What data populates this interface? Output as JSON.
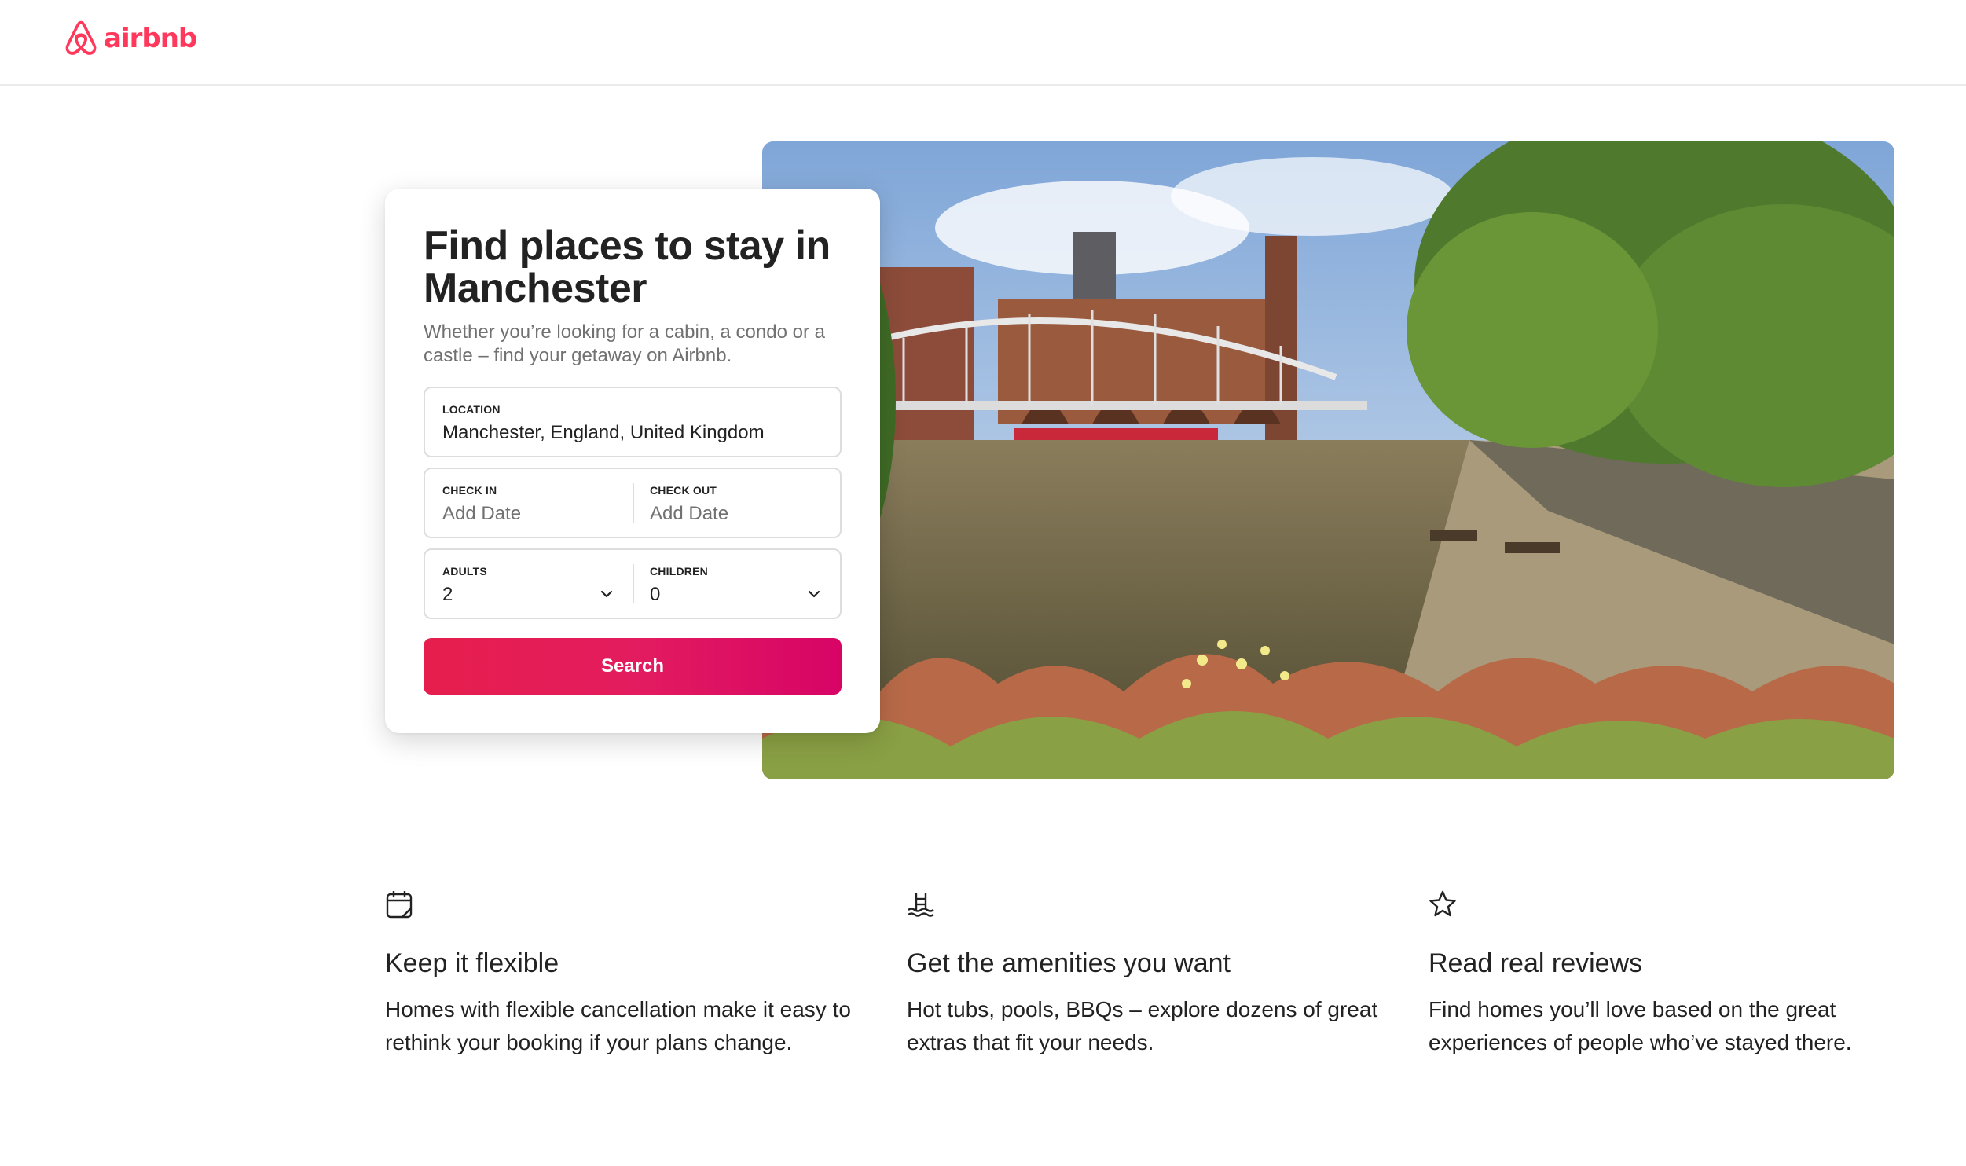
{
  "header": {
    "logo_text": "airbnb",
    "brand_color": "#ff385c"
  },
  "hero": {
    "image_description_icon": "photo"
  },
  "search_card": {
    "title": "Find places to stay in Manchester",
    "subtitle": "Whether you’re looking for a cabin, a condo or a castle – find your getaway on Airbnb.",
    "location": {
      "label": "LOCATION",
      "value": "Manchester, England, United Kingdom"
    },
    "check_in": {
      "label": "CHECK IN",
      "placeholder": "Add Date"
    },
    "check_out": {
      "label": "CHECK OUT",
      "placeholder": "Add Date"
    },
    "adults": {
      "label": "ADULTS",
      "value": "2"
    },
    "children": {
      "label": "CHILDREN",
      "value": "0"
    },
    "search_label": "Search",
    "button_color": "#e31c5f"
  },
  "features": [
    {
      "icon": "calendar-icon",
      "title": "Keep it flexible",
      "text": "Homes with flexible cancellation make it easy to rethink your booking if your plans change."
    },
    {
      "icon": "pool-icon",
      "title": "Get the amenities you want",
      "text": "Hot tubs, pools, BBQs – explore dozens of great extras that fit your needs."
    },
    {
      "icon": "star-icon",
      "title": "Read real reviews",
      "text": "Find homes you’ll love based on the great experiences of people who’ve stayed there."
    }
  ]
}
